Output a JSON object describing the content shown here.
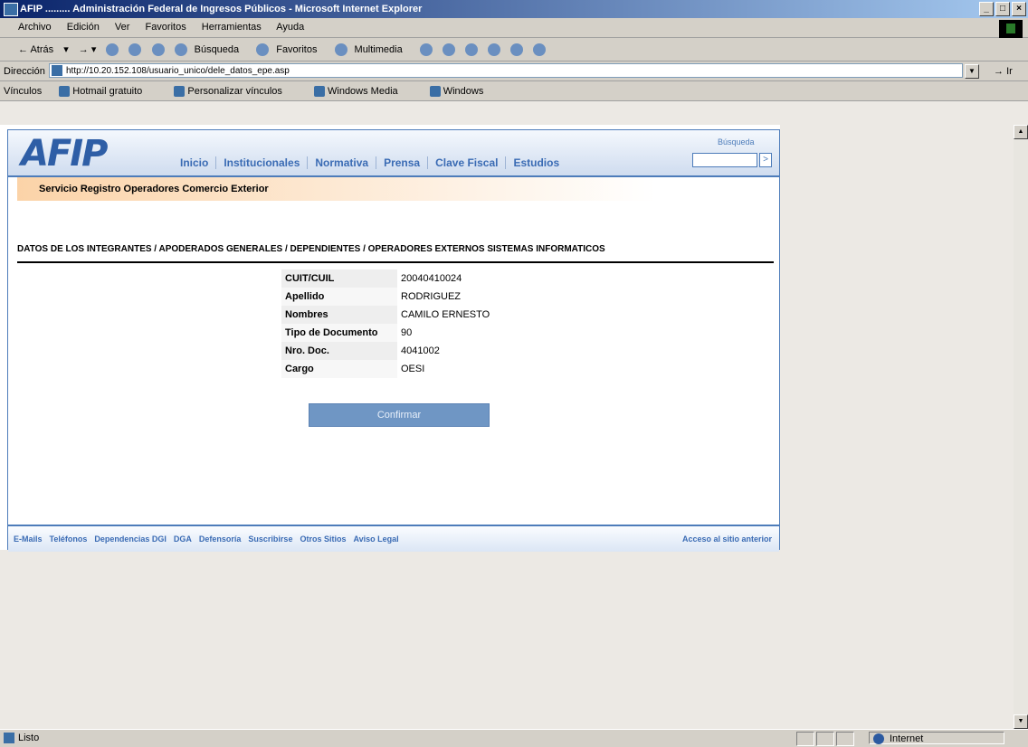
{
  "window": {
    "title": "AFIP ......... Administración Federal de Ingresos Públicos - Microsoft Internet Explorer",
    "buttons": [
      "_",
      "□",
      "×"
    ]
  },
  "menu": [
    "Archivo",
    "Edición",
    "Ver",
    "Favoritos",
    "Herramientas",
    "Ayuda"
  ],
  "toolbar": {
    "back": "Atrás",
    "search": "Búsqueda",
    "favorites": "Favoritos",
    "multimedia": "Multimedia"
  },
  "address": {
    "label": "Dirección",
    "url": "http://10.20.152.108/usuario_unico/dele_datos_epe.asp",
    "go": "Ir"
  },
  "links": {
    "label": "Vínculos",
    "items": [
      "Hotmail gratuito",
      "Personalizar vínculos",
      "Windows Media",
      "Windows"
    ]
  },
  "page": {
    "logo": "AFIP",
    "nav": [
      "Inicio",
      "Institucionales",
      "Normativa",
      "Prensa",
      "Clave Fiscal",
      "Estudios"
    ],
    "search_label": "Búsqueda",
    "search_go": ">",
    "service": "Servicio Registro Operadores Comercio Exterior",
    "section_title": "DATOS DE LOS INTEGRANTES / APODERADOS GENERALES / DEPENDIENTES / OPERADORES EXTERNOS SISTEMAS INFORMATICOS",
    "fields": [
      {
        "label": "CUIT/CUIL",
        "value": "20040410024"
      },
      {
        "label": "Apellido",
        "value": "RODRIGUEZ"
      },
      {
        "label": "Nombres",
        "value": "CAMILO ERNESTO"
      },
      {
        "label": "Tipo de Documento",
        "value": "90"
      },
      {
        "label": "Nro. Doc.",
        "value": "4041002"
      },
      {
        "label": "Cargo",
        "value": "OESI"
      }
    ],
    "confirm": "Confirmar",
    "footer_links": [
      "E-Mails",
      "Teléfonos",
      "Dependencias DGI",
      "DGA",
      "Defensoría",
      "Suscribirse",
      "Otros Sitios",
      "Aviso Legal"
    ],
    "footer_right": "Acceso al sitio anterior"
  },
  "status": {
    "text": "Listo",
    "zone": "Internet"
  }
}
